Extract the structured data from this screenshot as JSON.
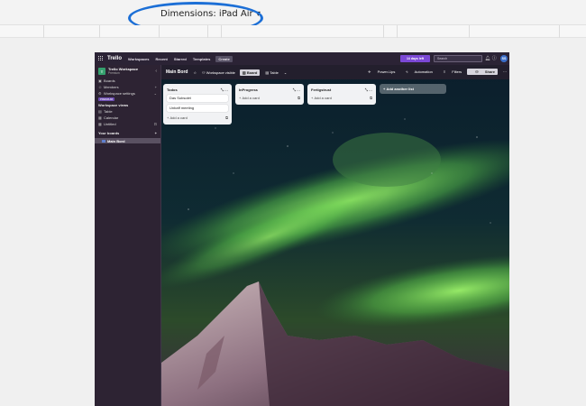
{
  "devtools": {
    "dimensions_label": "Dimensions: iPad Air",
    "dropdown_icon": "triangle-down-icon"
  },
  "topnav": {
    "logo": "Trello",
    "items": [
      "Workspaces",
      "Recent",
      "Starred",
      "Templates"
    ],
    "create": "Create",
    "trial": "14 days left",
    "search_placeholder": "Search",
    "avatar": "SS"
  },
  "sidebar": {
    "workspace_badge": "T",
    "workspace_name": "Trello Workspace",
    "workspace_plan": "Premium",
    "items": [
      {
        "label": "Boards",
        "icon": "board-icon"
      },
      {
        "label": "Members",
        "icon": "members-icon"
      },
      {
        "label": "Workspace settings",
        "icon": "settings-icon"
      }
    ],
    "premium_badge": "PREMIUM",
    "views_heading": "Workspace views",
    "views": [
      {
        "label": "Table",
        "icon": "table-icon"
      },
      {
        "label": "Calendar",
        "icon": "calendar-icon"
      },
      {
        "label": "Untitled",
        "icon": "view-icon"
      }
    ],
    "boards_heading": "Your boards",
    "active_board": "Main Bord"
  },
  "board": {
    "title": "Main Bord",
    "visibility": "Workspace visible",
    "board_btn": "Board",
    "table_btn": "Table",
    "power_ups": "Power-Ups",
    "automation": "Automation",
    "filters": "Filters",
    "share": "Share"
  },
  "lists": [
    {
      "title": "Todos",
      "cards": [
        "Das Subsolet",
        "Unbaff meeting"
      ],
      "add": "Add a card"
    },
    {
      "title": "InProgress",
      "cards": [],
      "add": "Add a card"
    },
    {
      "title": "Fertigstrust",
      "cards": [],
      "add": "Add a card"
    }
  ],
  "add_list": "Add another list"
}
